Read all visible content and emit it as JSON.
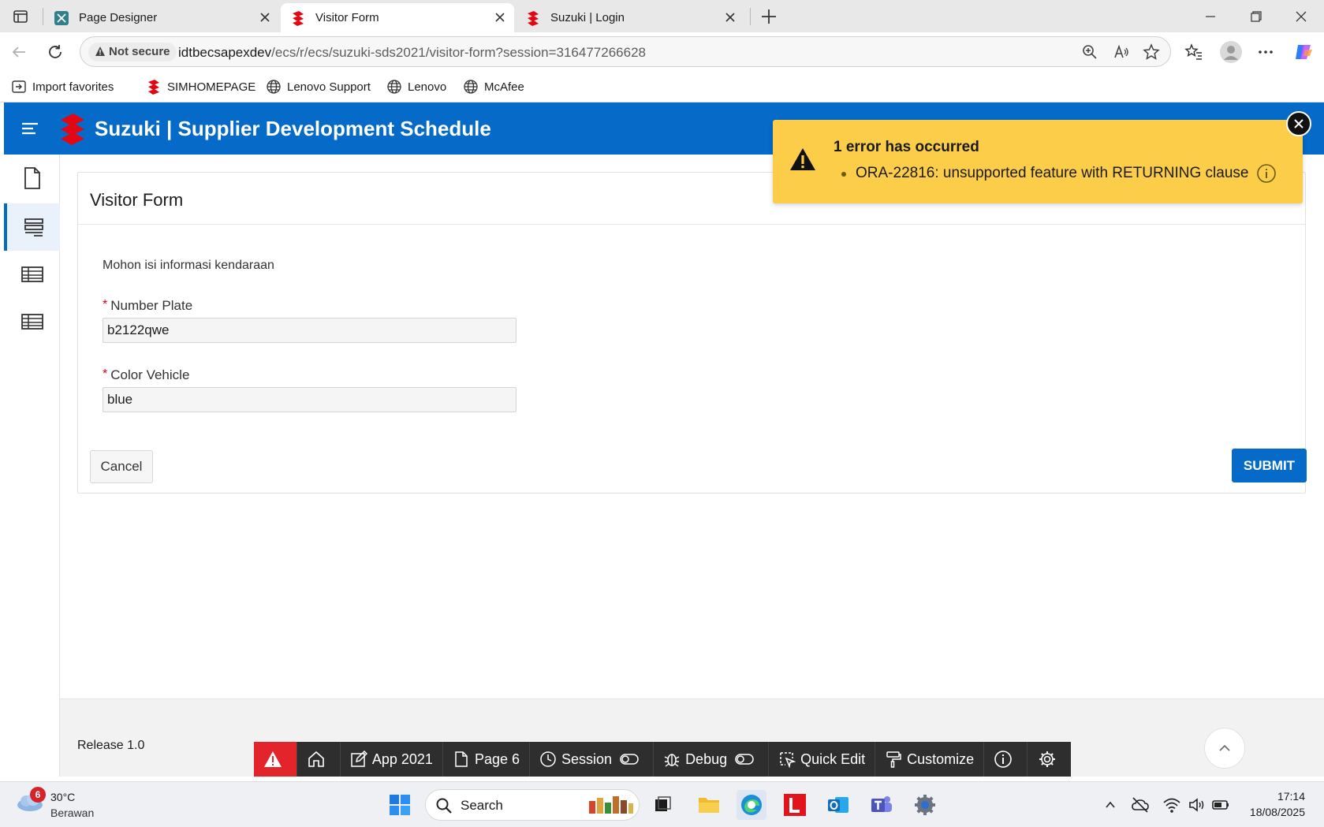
{
  "browser": {
    "tabs": [
      {
        "title": "Page Designer",
        "active": false
      },
      {
        "title": "Visitor Form",
        "active": true
      },
      {
        "title": "Suzuki | Login",
        "active": false
      }
    ],
    "security_label": "Not secure",
    "url_host": "idtbecsapexdev",
    "url_path": "/ecs/r/ecs/suzuki-sds2021/visitor-form?session=316477266628",
    "favorites": [
      "Import favorites",
      "SIMHOMEPAGE",
      "Lenovo Support",
      "Lenovo",
      "McAfee"
    ]
  },
  "app": {
    "title": "Suzuki | Supplier Development Schedule",
    "brand_color": "#056ac8",
    "sidenav_icons": [
      "document-icon",
      "form-icon",
      "table-icon",
      "table-icon"
    ],
    "region_title": "Visitor Form",
    "intro_text": "Mohon isi informasi kendaraan",
    "fields": [
      {
        "label": "Number Plate",
        "required_mark": "*",
        "value": "b2122qwe"
      },
      {
        "label": "Color Vehicle",
        "required_mark": "*",
        "value": "blue"
      }
    ],
    "cancel_label": "Cancel",
    "submit_label": "SUBMIT",
    "footer_text": "Release 1.0"
  },
  "error": {
    "title": "1 error has occurred",
    "message": "ORA-22816: unsupported feature with RETURNING clause",
    "color": "#fbcd48"
  },
  "devbar": {
    "app": "App 2021",
    "page": "Page 6",
    "session": "Session",
    "debug": "Debug",
    "quick_edit": "Quick Edit",
    "customize": "Customize"
  },
  "taskbar": {
    "weather_badge": "6",
    "weather_temp": "30°C",
    "weather_desc": "Berawan",
    "search_label": "Search",
    "time": "17:14",
    "date": "18/08/2025"
  }
}
